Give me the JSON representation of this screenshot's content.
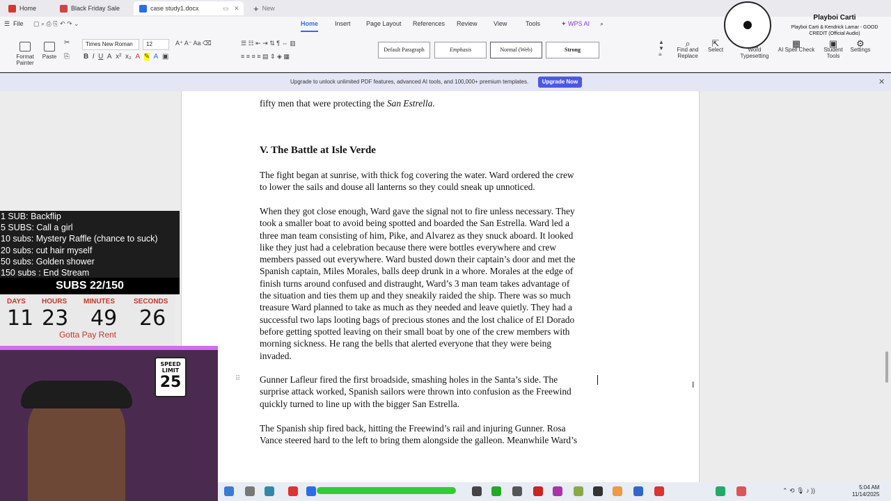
{
  "titlebar": {
    "tabs": [
      {
        "label": "Home"
      },
      {
        "label": "Black Friday Sale"
      },
      {
        "label": "case study1.docx"
      },
      {
        "label": "New"
      }
    ]
  },
  "menubar": {
    "file": "File",
    "items": [
      "Home",
      "Insert",
      "Page Layout",
      "References",
      "Review",
      "View",
      "Tools",
      "WPS AI"
    ]
  },
  "ribbon": {
    "format_painter": "Format Painter",
    "paste": "Paste",
    "font": "Times New Roman",
    "font_size": "12",
    "styles": [
      "Default Paragraph",
      "Emphasis",
      "Normal (Web)",
      "Strong"
    ],
    "find_replace": "Find and Replace",
    "select": "Select",
    "word_typesetting": "Word Typesetting",
    "ai_spell_check": "AI Spell Check",
    "student_tools": "Student Tools",
    "settings": "Settings"
  },
  "upgrade_bar": {
    "text": "Upgrade to unlock unlimited PDF features, advanced AI tools, and 100,000+ premium templates.",
    "button": "Upgrade Now"
  },
  "document": {
    "top_line": "fifty men that were protecting the",
    "top_line_italic": "San Estrella",
    "heading": "V. The Battle at Isle Verde",
    "p1": [
      "The fight began at sunrise, with thick fog covering the water. Ward ordered the crew",
      "to lower the sails and douse all lanterns so they could sneak up unnoticed."
    ],
    "p2": [
      "When they got close enough, Ward gave the signal not to fire unless necessary. They",
      "took a smaller boat to avoid being spotted and boarded the San Estrella. Ward led a",
      "three man team consisting of him, Pike, and Alvarez as they snuck aboard. It looked",
      "like they just had a celebration because there were bottles everywhere and crew",
      "members passed out everywhere. Ward busted down their captain’s door and met the",
      "Spanish captain, Miles Morales, balls deep drunk in a whore. Morales at the edge of",
      "finish turns around confused and distraught, Ward’s 3 man team takes advantage of",
      "the situation and ties them up and they sneakily raided the ship. There was so much",
      "treasure Ward planned to take as much as they needed and leave quietly. They had a",
      "successful two laps looting bags of precious stones and the lost chalice of El Dorado",
      "before getting spotted leaving on their small boat by one of the crew members with",
      "morning sickness. He rang the bells that alerted everyone that they were being",
      "invaded."
    ],
    "p3": [
      "Gunner Lafleur fired the first broadside, smashing holes in the Santa’s side. The",
      "surprise attack worked, Spanish sailors were thrown into confusion as the Freewind",
      "quickly turned to line up with the bigger San Estrella."
    ],
    "p4": [
      "The Spanish ship fired back, hitting the Freewind’s rail and injuring Gunner. Rosa",
      "Vance steered hard to the left to bring them alongside the galleon. Meanwhile Ward’s"
    ]
  },
  "stream_overlay": {
    "goals": [
      "1 SUB: Backflip",
      "5 SUBS: Call a girl",
      "10 subs: Mystery Raffle (chance to suck)",
      "20 subs: cut hair myself",
      "50 subs: Golden shower",
      "150 subs : End Stream"
    ],
    "sub_count": "SUBS 22/150",
    "timer_labels": [
      "DAYS",
      "HOURS",
      "MINUTES",
      "SECONDS"
    ],
    "timer_values": [
      "11",
      "23",
      "49",
      "26"
    ],
    "timer_caption": "Gotta Pay Rent",
    "speed_sign": {
      "top": "SPEED LIMIT",
      "number": "25"
    }
  },
  "music": {
    "artist": "Playboi Carti",
    "song": "Playboi Carti & Kendrick Lamar - GOOD CREDIT (Official Audio)"
  },
  "taskbar": {
    "time": "5:04 AM",
    "date": "11/14/2025"
  }
}
